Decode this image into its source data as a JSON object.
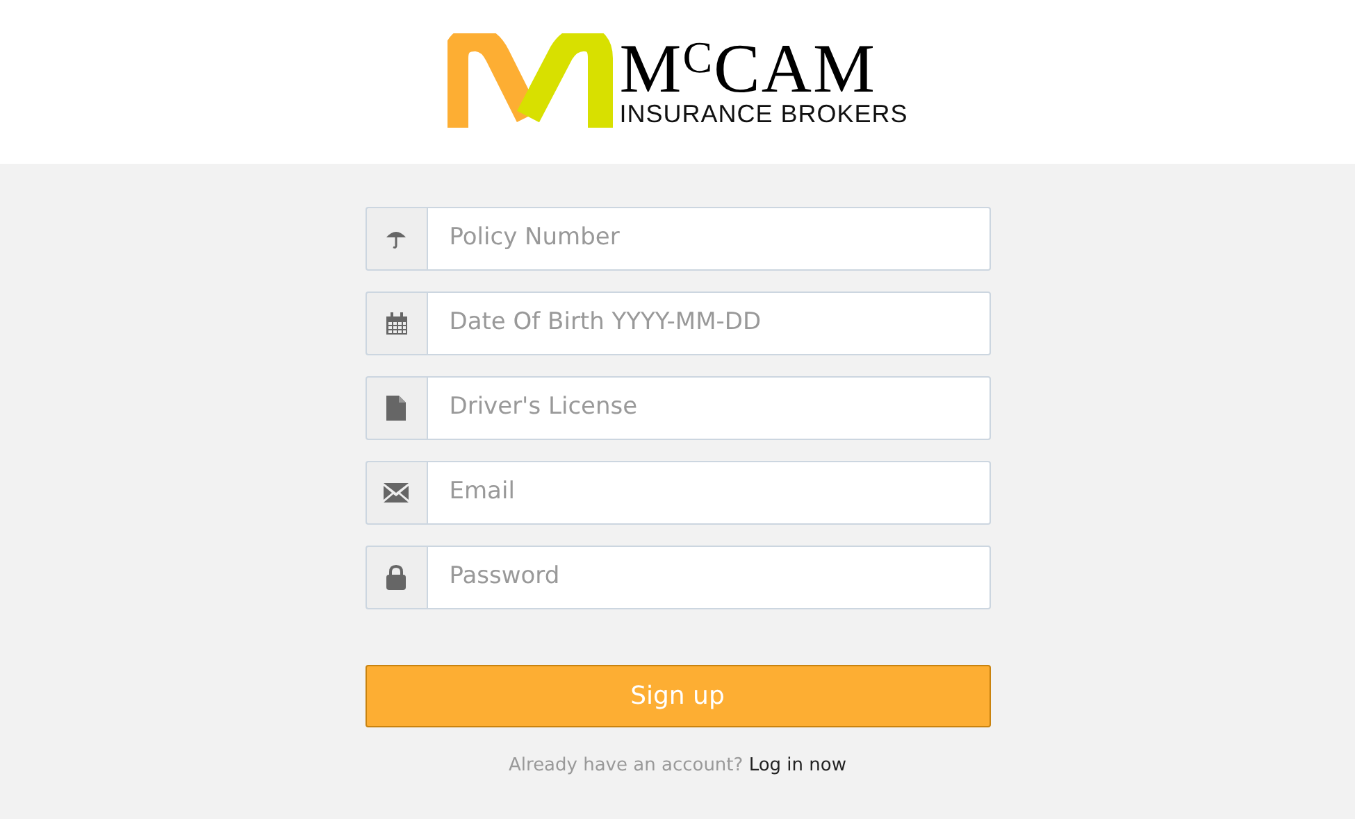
{
  "logo": {
    "name": "M$^{C}$CAM",
    "tagline": "INSURANCE BROKERS"
  },
  "fields": [
    {
      "kind": "umbrella",
      "placeholder": "Policy Number"
    },
    {
      "kind": "calendar",
      "placeholder": "Date Of Birth YYYY-MM-DD"
    },
    {
      "kind": "file",
      "placeholder": "Driver's License"
    },
    {
      "kind": "envelope",
      "placeholder": "Email"
    },
    {
      "kind": "lock",
      "placeholder": "Password"
    }
  ],
  "submit": {
    "label": "Sign up"
  },
  "footer": {
    "prompt": "Already have an account?",
    "link": "Log in now"
  }
}
